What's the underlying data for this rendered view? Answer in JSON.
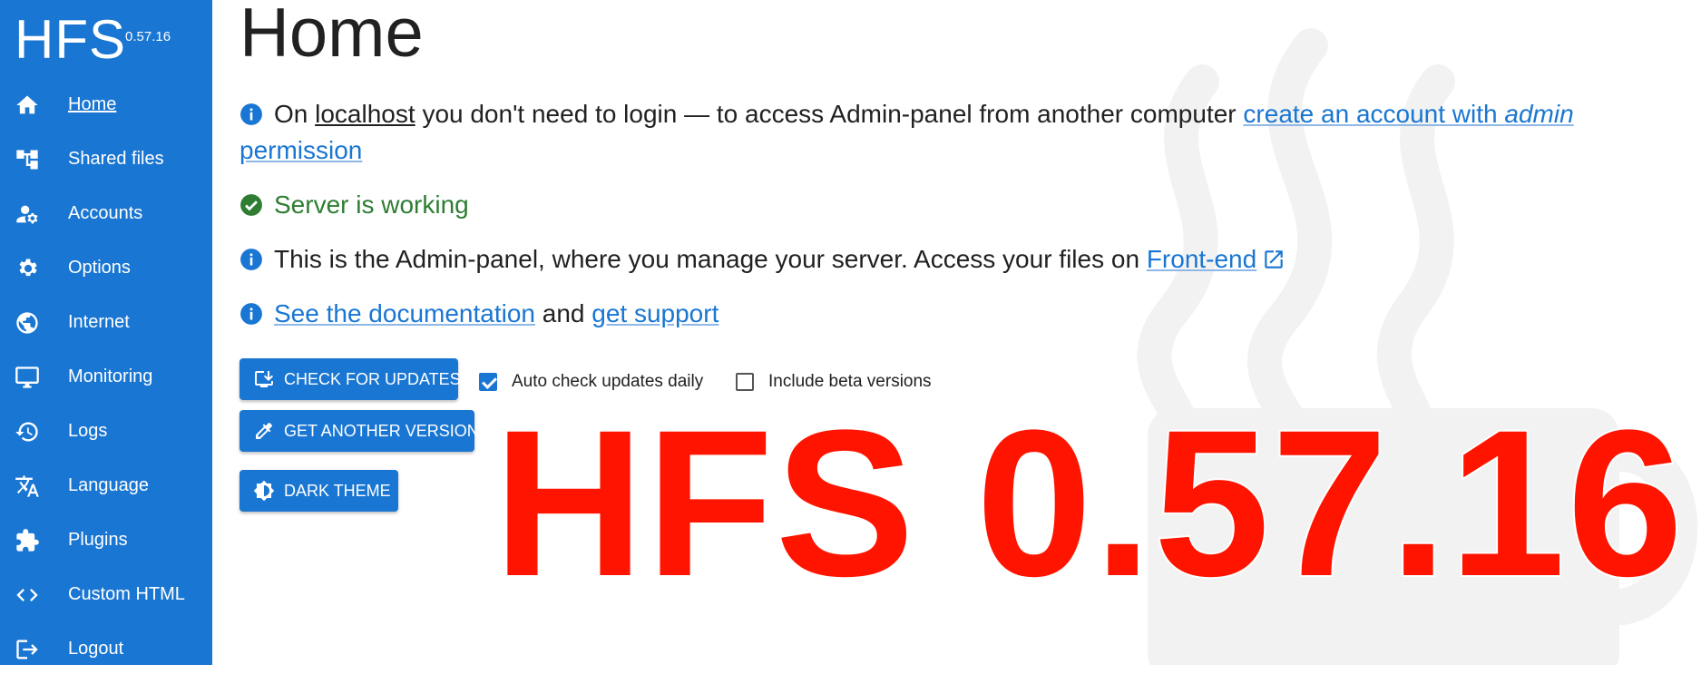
{
  "app": {
    "name": "HFS",
    "version": "0.57.16"
  },
  "sidebar": {
    "items": [
      {
        "label": "Home",
        "icon": "home-icon"
      },
      {
        "label": "Shared files",
        "icon": "tree-icon"
      },
      {
        "label": "Accounts",
        "icon": "manage-accounts-icon"
      },
      {
        "label": "Options",
        "icon": "gear-icon"
      },
      {
        "label": "Internet",
        "icon": "globe-icon"
      },
      {
        "label": "Monitoring",
        "icon": "monitor-icon"
      },
      {
        "label": "Logs",
        "icon": "history-icon"
      },
      {
        "label": "Language",
        "icon": "translate-icon"
      },
      {
        "label": "Plugins",
        "icon": "puzzle-icon"
      },
      {
        "label": "Custom HTML",
        "icon": "code-icon"
      },
      {
        "label": "Logout",
        "icon": "logout-icon"
      }
    ]
  },
  "main": {
    "title": "Home",
    "login_notice": {
      "prefix": "On",
      "host": "localhost",
      "middle": "you don't need to login — to access Admin-panel from another computer",
      "link_a": "create an account with",
      "link_em": "admin",
      "link_b": "permission"
    },
    "server_status": "Server is working",
    "frontend_notice": {
      "text": "This is the Admin-panel, where you manage your server. Access your files on",
      "link": "Front-end"
    },
    "docs_notice": {
      "link1": "See the documentation",
      "and": "and",
      "link2": "get support"
    },
    "buttons": {
      "check_updates": "CHECK FOR UPDATES",
      "another_version": "GET ANOTHER VERSION",
      "dark_theme": "DARK THEME"
    },
    "checkboxes": {
      "auto_check": {
        "label": "Auto check updates daily",
        "checked": true
      },
      "beta": {
        "label": "Include beta versions",
        "checked": false
      }
    }
  },
  "overlay_text": "HFS 0.57.16",
  "colors": {
    "primary": "#1976d2",
    "success": "#2e7d32",
    "overlay": "#ff1400"
  }
}
